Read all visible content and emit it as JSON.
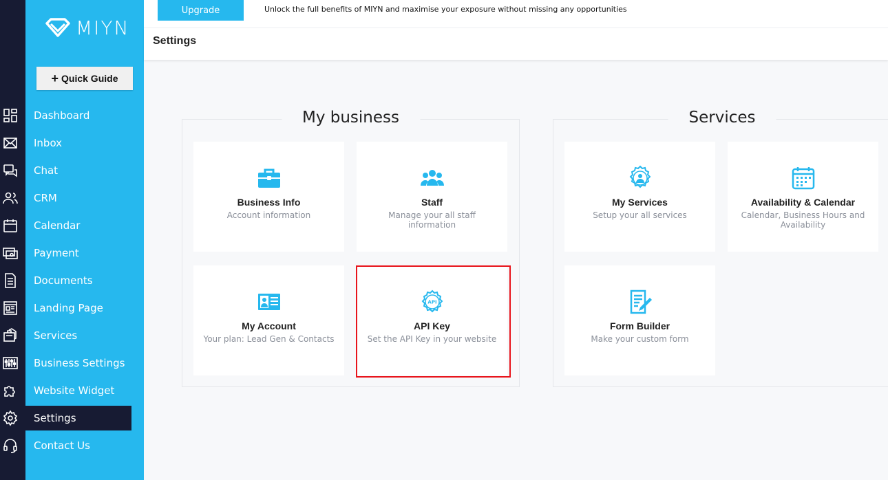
{
  "brand": {
    "name": "MIYN",
    "accent": "#26b8ee",
    "dark": "#171b33"
  },
  "sidebar": {
    "quick_guide": "Quick Guide",
    "items": [
      {
        "label": "Dashboard",
        "icon": "dashboard-icon"
      },
      {
        "label": "Inbox",
        "icon": "mail-icon"
      },
      {
        "label": "Chat",
        "icon": "chat-icon"
      },
      {
        "label": "CRM",
        "icon": "users-icon"
      },
      {
        "label": "Calendar",
        "icon": "calendar-icon"
      },
      {
        "label": "Payment",
        "icon": "payment-icon"
      },
      {
        "label": "Documents",
        "icon": "document-icon"
      },
      {
        "label": "Landing Page",
        "icon": "landing-page-icon"
      },
      {
        "label": "Services",
        "icon": "services-icon"
      },
      {
        "label": "Business Settings",
        "icon": "sliders-icon"
      },
      {
        "label": "Website Widget",
        "icon": "puzzle-icon"
      },
      {
        "label": "Settings",
        "icon": "gear-icon",
        "active": true
      },
      {
        "label": "Contact Us",
        "icon": "headset-icon"
      }
    ]
  },
  "topbar": {
    "upgrade_label": "Upgrade",
    "promo_text": "Unlock the full benefits of MIYN and maximise your exposure without missing any opportunities"
  },
  "page": {
    "title": "Settings"
  },
  "groups": {
    "my_business": {
      "title": "My business",
      "cards": [
        {
          "title": "Business Info",
          "subtitle": "Account information",
          "icon": "briefcase-icon"
        },
        {
          "title": "Staff",
          "subtitle": "Manage your all staff information",
          "icon": "team-icon"
        },
        {
          "title": "My Account",
          "subtitle": "Your plan: Lead Gen & Contacts",
          "icon": "id-card-icon"
        },
        {
          "title": "API Key",
          "subtitle": "Set the API Key in your website",
          "icon": "api-gear-icon",
          "highlighted": true
        }
      ]
    },
    "services": {
      "title": "Services",
      "cards": [
        {
          "title": "My Services",
          "subtitle": "Setup your all services",
          "icon": "user-gear-icon"
        },
        {
          "title": "Availability & Calendar",
          "subtitle": "Calendar, Business Hours and Availability",
          "icon": "calendar-grid-icon"
        },
        {
          "title": "Form Builder",
          "subtitle": "Make your custom form",
          "icon": "form-edit-icon"
        }
      ]
    }
  }
}
